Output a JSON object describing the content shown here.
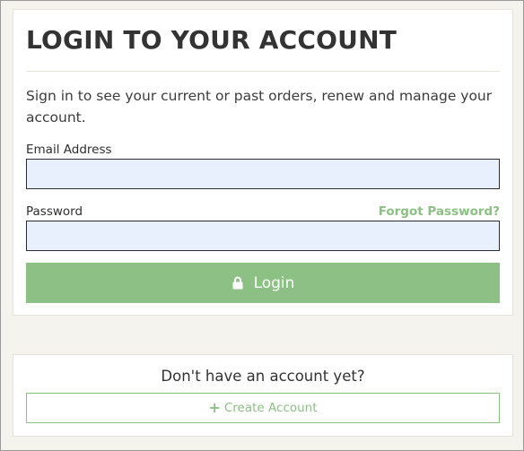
{
  "login": {
    "title": "LOGIN TO YOUR ACCOUNT",
    "intro": "Sign in to see your current or past orders, renew and manage your account.",
    "email_label": "Email Address",
    "email_value": "",
    "password_label": "Password",
    "password_value": "",
    "forgot_link": "Forgot Password?",
    "login_button": "Login",
    "login_icon": "lock-icon"
  },
  "signup": {
    "prompt": "Don't have an account yet?",
    "create_button": "Create Account",
    "create_icon": "plus-icon"
  },
  "colors": {
    "accent": "#8cc084",
    "input_background": "#e8f0fe",
    "page_background": "#f5f3ee",
    "heading": "#333333"
  }
}
